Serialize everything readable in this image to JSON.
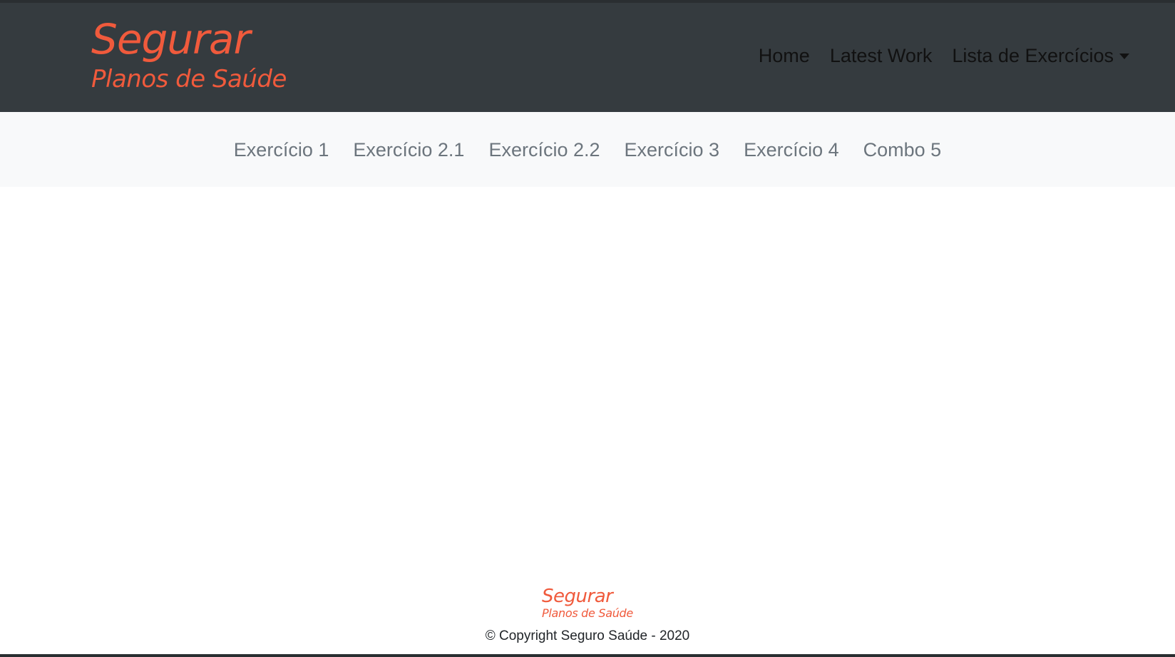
{
  "header": {
    "logo": {
      "line1": "Segurar",
      "line2": "Planos de Saúde"
    },
    "nav": [
      {
        "label": "Home"
      },
      {
        "label": "Latest Work"
      },
      {
        "label": "Lista de Exercícios",
        "dropdown": true
      }
    ]
  },
  "subnav": [
    {
      "label": "Exercício 1"
    },
    {
      "label": "Exercício 2.1"
    },
    {
      "label": "Exercício 2.2"
    },
    {
      "label": "Exercício 3"
    },
    {
      "label": "Exercício 4"
    },
    {
      "label": "Combo 5"
    }
  ],
  "footer": {
    "logo": {
      "line1": "Segurar",
      "line2": "Planos de Saúde"
    },
    "copyright": "© Copyright Seguro Saúde - 2020"
  },
  "colors": {
    "navbar_bg": "#353b3f",
    "brand": "#f05a3c",
    "subnav_bg": "#f8f9fa",
    "subnav_link": "#6c757d"
  },
  "icons": {
    "dropdown": "caret-down-icon"
  }
}
